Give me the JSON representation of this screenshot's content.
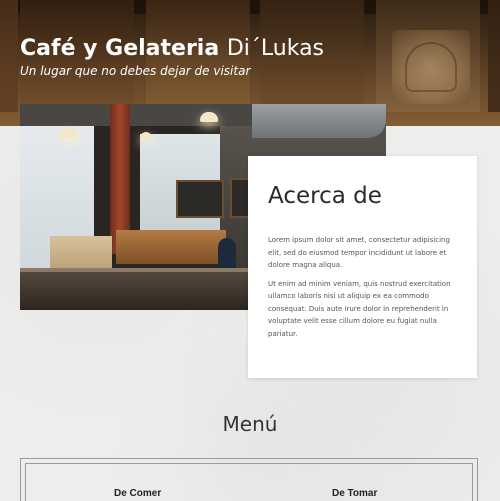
{
  "header": {
    "title_bold": "Café y Gelateria",
    "title_light": "Di´Lukas",
    "tagline": "Un lugar que no debes dejar de visitar"
  },
  "about": {
    "title": "Acerca de",
    "paragraphs": [
      "Lorem ipsum dolor sit amet, consectetur adipisicing elit, sed do eiusmod tempor incididunt ut labore et dolore magna aliqua.",
      "Ut enim ad minim veniam, quis nostrud exercitation ullamco laboris nisi ut aliquip ex ea commodo consequat. Duis aute irure dolor in reprehenderit in voluptate velit esse cillum dolore eu fugiat nulla pariatur."
    ]
  },
  "menu": {
    "heading": "Menú",
    "columns": [
      {
        "title": "De Comer"
      },
      {
        "title": "De Tomar"
      }
    ]
  },
  "colors": {
    "page_background": "#ededeb",
    "card_background": "#ffffff",
    "title_text": "#ffffff",
    "body_text": "#555555"
  }
}
